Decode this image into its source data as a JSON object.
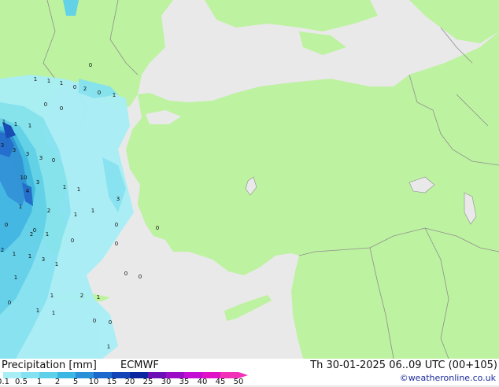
{
  "footer": {
    "title": "Precipitation [mm]",
    "model": "ECMWF",
    "valid": "Th 30-01-2025 06..09 UTC (00+105)",
    "credit": "©weatheronline.co.uk"
  },
  "legend": {
    "ticks": [
      "0.1",
      "0.5",
      "1",
      "2",
      "5",
      "10",
      "15",
      "20",
      "25",
      "30",
      "35",
      "40",
      "45",
      "50"
    ],
    "colors": [
      "#a8eef6",
      "#84e2f0",
      "#5fd0ea",
      "#3cb6e2",
      "#2a90d8",
      "#1c68cc",
      "#1244b8",
      "#0b25a0",
      "#6c0fb6",
      "#9a0cc6",
      "#c40ed6",
      "#e010c6",
      "#f230b8"
    ]
  },
  "map": {
    "colors": {
      "land": "#bdf2a0",
      "sea": "#e9e9e9",
      "border": "#8f8f8f"
    },
    "station_values": [
      "0",
      "1",
      "1",
      "1",
      "0",
      "2",
      "0",
      "1",
      "0",
      "0",
      "1",
      "1",
      "1",
      "3",
      "3",
      "3",
      "3",
      "0",
      "10",
      "3",
      "4",
      "1",
      "1",
      "2",
      "1",
      "0",
      "0",
      "2",
      "1",
      "2",
      "1",
      "1",
      "3",
      "1",
      "3",
      "1",
      "0",
      "0",
      "1",
      "2",
      "1",
      "0",
      "1",
      "1",
      "0",
      "0",
      "1",
      "0",
      "0",
      "0",
      "1",
      "1",
      "0"
    ]
  }
}
